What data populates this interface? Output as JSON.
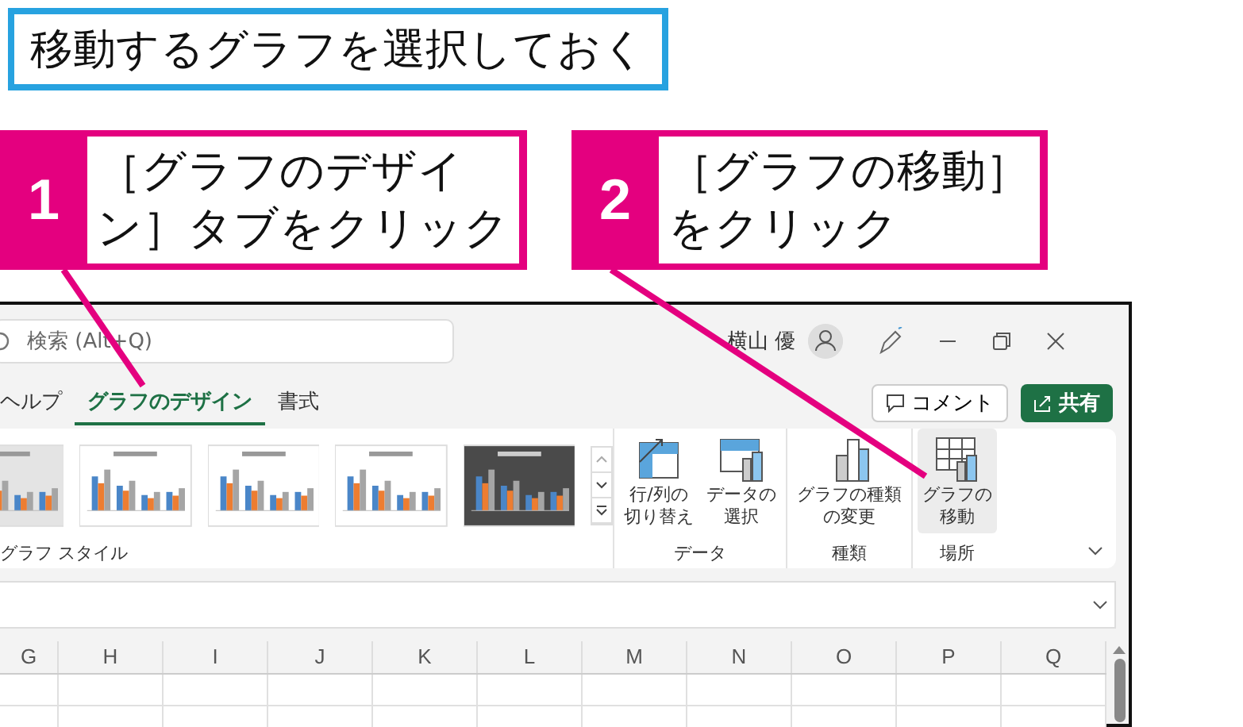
{
  "banner": {
    "text": "移動するグラフを選択しておく"
  },
  "callouts": [
    {
      "number": "1",
      "lines": [
        "［グラフのデザイ",
        "ン］タブをクリック"
      ]
    },
    {
      "number": "2",
      "lines": [
        "［グラフの移動］",
        "をクリック"
      ]
    }
  ],
  "window": {
    "search": {
      "placeholder": "検索 (Alt+Q)"
    },
    "user": "横山 優"
  },
  "tabs": [
    {
      "label": "ヘルプ",
      "selected": false
    },
    {
      "label": "グラフのデザイン",
      "selected": true
    },
    {
      "label": "書式",
      "selected": false
    }
  ],
  "actions": {
    "comment": "コメント",
    "share": "共有"
  },
  "gallery": {
    "label": "グラフ スタイル",
    "styles": [
      {
        "kind": "gray"
      },
      {
        "kind": "light"
      },
      {
        "kind": "light"
      },
      {
        "kind": "light"
      },
      {
        "kind": "dark"
      }
    ]
  },
  "groups": [
    {
      "label": "データ",
      "buttons": [
        {
          "kind": "switch",
          "lines": [
            "行/列の",
            "切り替え"
          ],
          "selected": false
        },
        {
          "kind": "select",
          "lines": [
            "データの",
            "選択"
          ],
          "selected": false
        }
      ]
    },
    {
      "label": "種類",
      "buttons": [
        {
          "kind": "type",
          "lines": [
            "グラフの種類",
            "の変更"
          ],
          "selected": false
        }
      ]
    },
    {
      "label": "場所",
      "buttons": [
        {
          "kind": "move",
          "lines": [
            "グラフの",
            "移動"
          ],
          "selected": true
        }
      ]
    }
  ],
  "columns": [
    "G",
    "H",
    "I",
    "J",
    "K",
    "L",
    "M",
    "N",
    "O",
    "P",
    "Q"
  ]
}
